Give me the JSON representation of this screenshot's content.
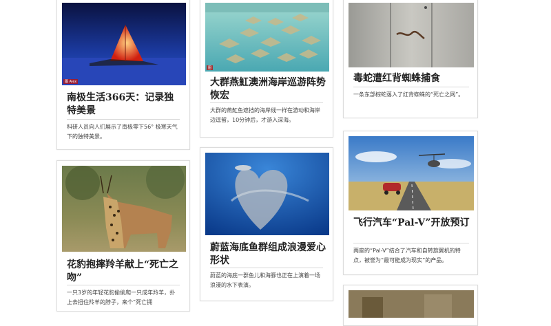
{
  "cards": [
    {
      "title": "南极生活366天：记录独特美景",
      "desc": "科研人员向人们展示了南极零下56° 极寒天气下的独特美景。"
    },
    {
      "title": "大群燕魟澳洲海岸巡游阵势恢宏",
      "desc": "大群的燕魟鱼遮挡的海岸线一样在游动和海岸边逗留，10分钟后，才游入深海。"
    },
    {
      "title": "毒蛇遭红背蜘蛛捕食",
      "desc": "一条东部棕蛇落入了红背蜘蛛的“死亡之网”。"
    },
    {
      "title": "花豹抱摔羚羊献上“死亡之吻”",
      "desc": "一只3岁的年轻花豹偷偷爬一只成年羚羊，扑上去扭住羚羊的脖子，来个“死亡拥"
    },
    {
      "title": "蔚蓝海底鱼群组成浪漫爱心形状",
      "desc": "蔚蓝的海底一群鱼儿和海豚也正在上演着一场浪漫的水下表演。"
    },
    {
      "title": "飞行汽车“Pal-V”开放预订",
      "desc": "两座的“Pal-V”结合了汽车和自转旋翼机的特点，被誉为“最可能成为现实”的产品。"
    }
  ]
}
